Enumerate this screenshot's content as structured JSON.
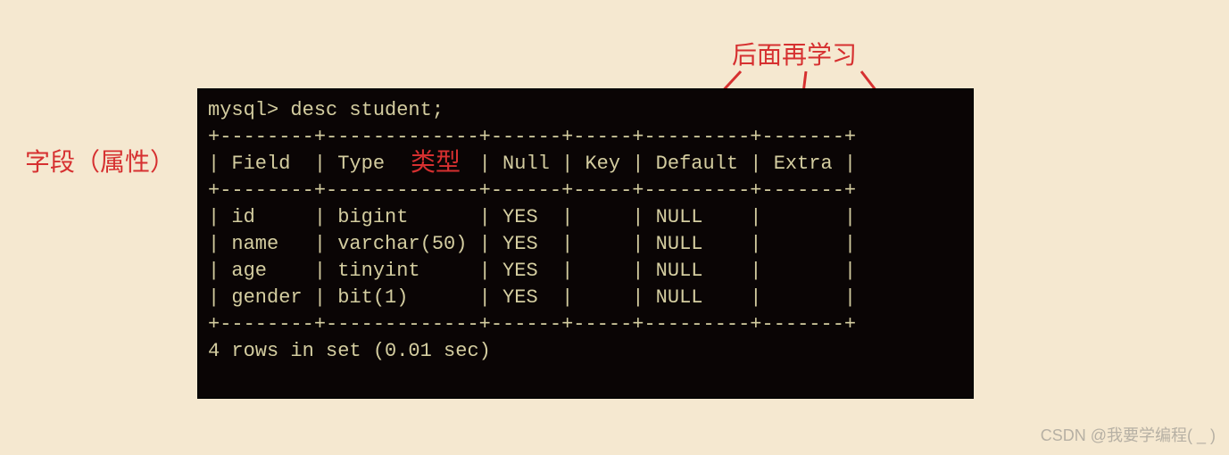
{
  "annotations": {
    "top": "后面再学习",
    "left": "字段（属性）",
    "type": "类型"
  },
  "terminal": {
    "prompt": "mysql> desc student;",
    "border_top": "+--------+-------------+------+-----+---------+-------+",
    "header": "| Field  | Type        | Null | Key | Default | Extra |",
    "border_mid": "+--------+-------------+------+-----+---------+-------+",
    "rows": [
      "| id     | bigint      | YES  |     | NULL    |       |",
      "| name   | varchar(50) | YES  |     | NULL    |       |",
      "| age    | tinyint     | YES  |     | NULL    |       |",
      "| gender | bit(1)      | YES  |     | NULL    |       |"
    ],
    "border_bot": "+--------+-------------+------+-----+---------+-------+",
    "footer": "4 rows in set (0.01 sec)"
  },
  "chart_data": {
    "type": "table",
    "title": "desc student",
    "columns": [
      "Field",
      "Type",
      "Null",
      "Key",
      "Default",
      "Extra"
    ],
    "rows": [
      {
        "Field": "id",
        "Type": "bigint",
        "Null": "YES",
        "Key": "",
        "Default": "NULL",
        "Extra": ""
      },
      {
        "Field": "name",
        "Type": "varchar(50)",
        "Null": "YES",
        "Key": "",
        "Default": "NULL",
        "Extra": ""
      },
      {
        "Field": "age",
        "Type": "tinyint",
        "Null": "YES",
        "Key": "",
        "Default": "NULL",
        "Extra": ""
      },
      {
        "Field": "gender",
        "Type": "bit(1)",
        "Null": "YES",
        "Key": "",
        "Default": "NULL",
        "Extra": ""
      }
    ]
  },
  "watermark": "CSDN @我要学编程( _ )"
}
